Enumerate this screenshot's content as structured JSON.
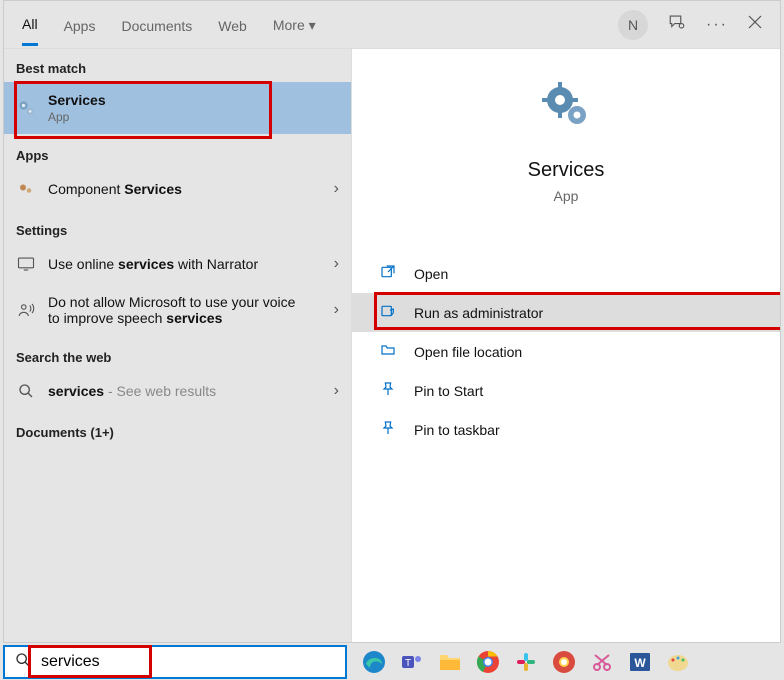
{
  "tabs": {
    "all": "All",
    "apps": "Apps",
    "documents": "Documents",
    "web": "Web",
    "more": "More"
  },
  "avatar_initial": "N",
  "sections": {
    "best_match": "Best match",
    "apps": "Apps",
    "settings": "Settings",
    "search_web": "Search the web",
    "documents": "Documents (1+)"
  },
  "best_match": {
    "title": "Services",
    "sub": "App"
  },
  "apps_row": {
    "pre": "Component ",
    "bold": "Services"
  },
  "settings_rows": {
    "r1_pre": "Use online ",
    "r1_bold": "services",
    "r1_post": " with Narrator",
    "r2_pre": "Do not allow Microsoft to use your voice to improve speech ",
    "r2_bold": "services"
  },
  "web_row": {
    "bold": "services",
    "post": " - See web results"
  },
  "hero": {
    "title": "Services",
    "sub": "App"
  },
  "actions": {
    "open": "Open",
    "run_admin": "Run as administrator",
    "open_loc": "Open file location",
    "pin_start": "Pin to Start",
    "pin_taskbar": "Pin to taskbar"
  },
  "search": {
    "value": "services"
  }
}
